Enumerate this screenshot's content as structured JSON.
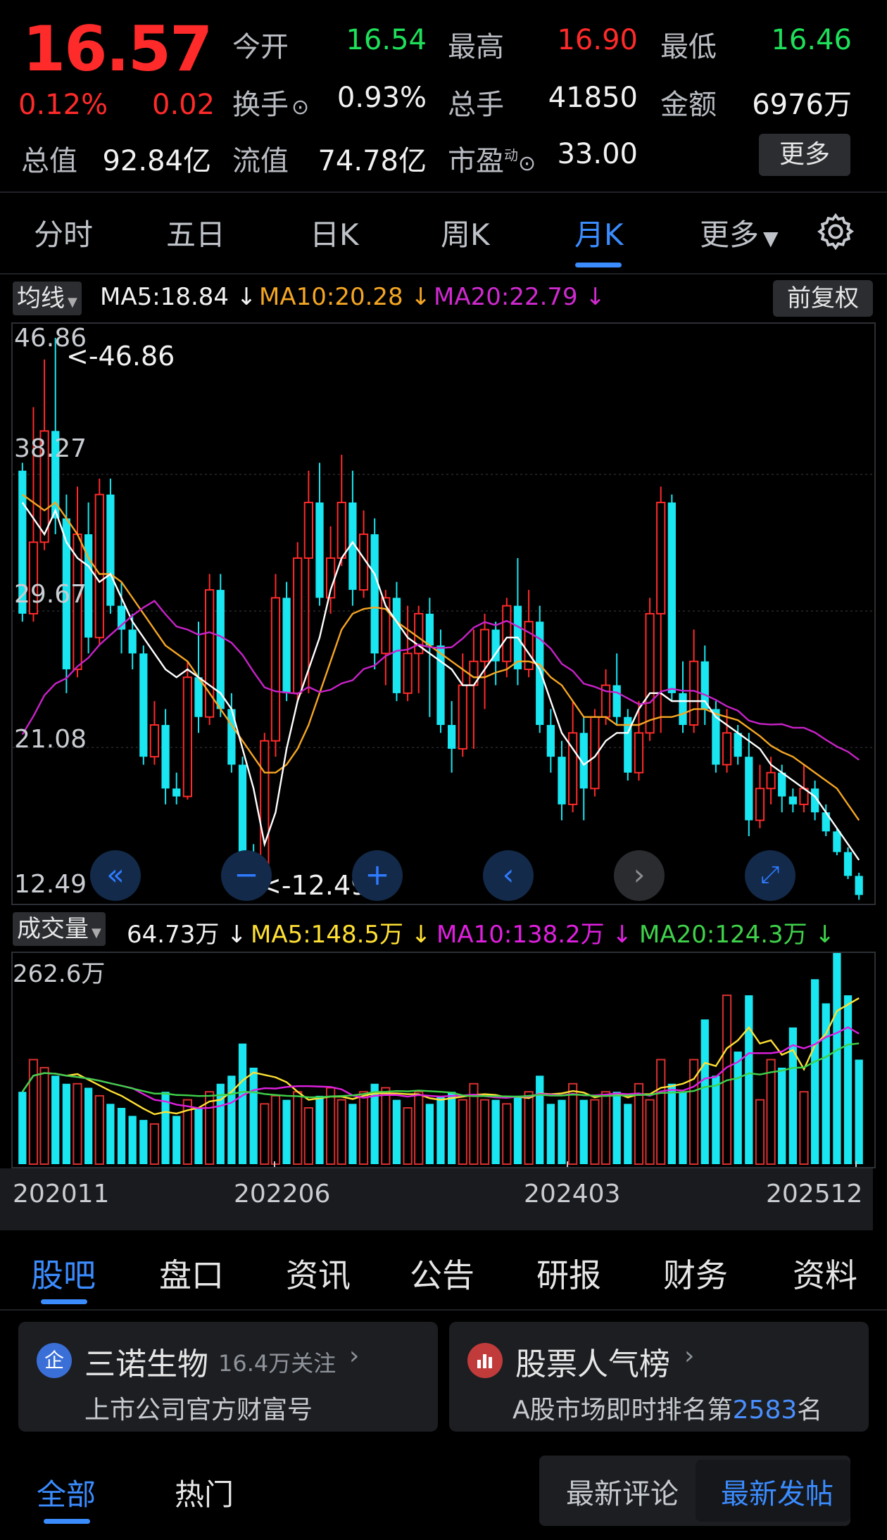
{
  "quote": {
    "price": "16.57",
    "change_pct": "0.12%",
    "change": "0.02",
    "open_label": "今开",
    "open": "16.54",
    "high_label": "最高",
    "high": "16.90",
    "low_label": "最低",
    "low": "16.46",
    "turnover_label": "换手",
    "turnover": "0.93%",
    "volume_label": "总手",
    "volume": "41850",
    "amount_label": "金额",
    "amount": "6976万",
    "mktcap_label": "总值",
    "mktcap": "92.84亿",
    "float_label": "流值",
    "float_cap": "74.78亿",
    "pe_label": "市盈",
    "pe_sup": "动",
    "pe": "33.00",
    "more_label": "更多"
  },
  "period_tabs": [
    "分时",
    "五日",
    "日K",
    "周K",
    "月K",
    "更多"
  ],
  "active_period": "月K",
  "kline": {
    "indicator_label": "均线",
    "ma5": "MA5:18.84 ↓",
    "ma10": "MA10:20.28 ↓",
    "ma20": "MA20:22.79 ↓",
    "adjust_label": "前复权",
    "y_ticks": [
      "46.86",
      "38.27",
      "29.67",
      "21.08",
      "12.49"
    ],
    "max_marker": "<-46.86",
    "min_marker": "<-12.49",
    "colors": {
      "up": "#ff2a2a",
      "down": "#19e6f0",
      "ma5": "#ffffff",
      "ma10": "#f5a623",
      "ma20": "#c822c8"
    }
  },
  "volume": {
    "indicator_label": "成交量",
    "vol": "64.73万 ↓",
    "ma5": "MA5:148.5万 ↓",
    "ma10": "MA10:138.2万 ↓",
    "ma20": "MA20:124.3万 ↓",
    "y_max": "262.6万",
    "x_ticks": [
      "202011",
      "202206",
      "202403",
      "202512"
    ],
    "colors": {
      "ma5": "#ffe033",
      "ma10": "#e020e0",
      "ma20": "#3fd24a"
    }
  },
  "chart_data": {
    "type": "candlestick",
    "candles": [
      [
        38.5,
        29.5,
        39.0,
        29.0
      ],
      [
        29.5,
        34.0,
        42.5,
        29.0
      ],
      [
        34.0,
        41.0,
        45.5,
        33.5
      ],
      [
        41.0,
        35.5,
        46.86,
        34.5
      ],
      [
        35.5,
        26.0,
        37.0,
        24.5
      ],
      [
        26.0,
        34.5,
        37.5,
        25.5
      ],
      [
        34.5,
        28.0,
        36.5,
        27.0
      ],
      [
        28.0,
        37.0,
        38.0,
        27.5
      ],
      [
        37.0,
        30.0,
        38.0,
        29.5
      ],
      [
        30.0,
        28.5,
        31.5,
        27.0
      ],
      [
        28.5,
        27.0,
        29.5,
        26.0
      ],
      [
        27.0,
        20.5,
        27.5,
        20.0
      ],
      [
        20.5,
        22.5,
        24.0,
        20.0
      ],
      [
        22.5,
        18.5,
        23.5,
        17.5
      ],
      [
        18.5,
        18.0,
        19.5,
        17.5
      ],
      [
        18.0,
        25.5,
        26.5,
        17.8
      ],
      [
        25.5,
        23.0,
        29.0,
        22.0
      ],
      [
        23.0,
        31.0,
        32.0,
        22.5
      ],
      [
        31.0,
        23.5,
        32.0,
        23.0
      ],
      [
        23.5,
        20.0,
        24.5,
        19.5
      ],
      [
        20.0,
        14.0,
        20.5,
        13.5
      ],
      [
        14.0,
        12.8,
        15.0,
        12.49
      ],
      [
        12.8,
        21.5,
        22.0,
        12.6
      ],
      [
        21.5,
        30.5,
        32.0,
        20.5
      ],
      [
        30.5,
        24.5,
        31.5,
        24.0
      ],
      [
        24.5,
        33.0,
        34.0,
        24.0
      ],
      [
        33.0,
        36.5,
        38.5,
        24.5
      ],
      [
        36.5,
        30.5,
        39.0,
        30.0
      ],
      [
        30.5,
        33.0,
        35.0,
        29.5
      ],
      [
        33.0,
        36.5,
        39.5,
        32.5
      ],
      [
        36.5,
        31.0,
        38.5,
        30.0
      ],
      [
        31.0,
        34.5,
        36.0,
        30.5
      ],
      [
        34.5,
        27.0,
        35.5,
        26.0
      ],
      [
        27.0,
        30.5,
        31.0,
        25.0
      ],
      [
        30.5,
        24.5,
        31.5,
        24.0
      ],
      [
        24.5,
        27.0,
        30.0,
        24.0
      ],
      [
        27.0,
        29.5,
        30.0,
        24.5
      ],
      [
        29.5,
        27.5,
        30.5,
        23.0
      ],
      [
        27.5,
        22.5,
        28.5,
        22.0
      ],
      [
        22.5,
        21.0,
        24.0,
        19.5
      ],
      [
        21.0,
        25.0,
        27.0,
        20.5
      ],
      [
        25.0,
        26.5,
        28.5,
        21.0
      ],
      [
        26.5,
        28.5,
        29.5,
        23.5
      ],
      [
        28.5,
        26.5,
        29.0,
        25.0
      ],
      [
        26.5,
        30.0,
        30.5,
        25.5
      ],
      [
        30.0,
        26.0,
        33.0,
        25.0
      ],
      [
        26.0,
        29.0,
        31.0,
        25.5
      ],
      [
        29.0,
        22.5,
        30.0,
        22.0
      ],
      [
        22.5,
        20.5,
        23.5,
        19.5
      ],
      [
        20.5,
        17.5,
        21.5,
        16.5
      ],
      [
        17.5,
        22.0,
        24.0,
        17.0
      ],
      [
        22.0,
        18.5,
        23.0,
        16.5
      ],
      [
        18.5,
        23.0,
        23.5,
        18.0
      ],
      [
        23.0,
        25.0,
        26.0,
        22.5
      ],
      [
        25.0,
        23.0,
        27.0,
        22.5
      ],
      [
        23.0,
        19.5,
        23.5,
        19.0
      ],
      [
        19.5,
        22.0,
        24.0,
        19.0
      ],
      [
        22.0,
        29.5,
        30.5,
        21.5
      ],
      [
        29.5,
        36.5,
        37.5,
        22.0
      ],
      [
        36.5,
        24.5,
        37.0,
        24.0
      ],
      [
        24.5,
        22.5,
        26.5,
        22.0
      ],
      [
        22.5,
        26.5,
        28.5,
        22.0
      ],
      [
        26.5,
        23.5,
        27.5,
        22.5
      ],
      [
        23.5,
        20.0,
        24.0,
        19.5
      ],
      [
        20.0,
        22.0,
        23.5,
        19.5
      ],
      [
        22.0,
        20.5,
        22.5,
        20.0
      ],
      [
        20.5,
        16.5,
        22.0,
        15.5
      ],
      [
        16.5,
        18.5,
        20.0,
        16.0
      ],
      [
        18.5,
        19.5,
        20.5,
        17.5
      ],
      [
        19.5,
        18.0,
        20.0,
        17.0
      ],
      [
        18.0,
        17.5,
        18.5,
        17.0
      ],
      [
        17.5,
        18.5,
        20.0,
        17.0
      ],
      [
        18.5,
        17.0,
        19.0,
        16.5
      ],
      [
        17.0,
        15.8,
        17.5,
        15.5
      ],
      [
        15.8,
        14.5,
        16.0,
        14.3
      ],
      [
        14.5,
        13.0,
        14.8,
        12.8
      ],
      [
        13.0,
        11.8,
        13.2,
        11.5
      ]
    ],
    "ma5": [
      36.5,
      35.5,
      34.5,
      36,
      34,
      33,
      32.5,
      31.5,
      32,
      30.5,
      29,
      28,
      27,
      26,
      25.5,
      26,
      25.5,
      25,
      24.5,
      23.5,
      21,
      18.5,
      15,
      17,
      21,
      24,
      26,
      28,
      31,
      33,
      34,
      33,
      32,
      30,
      29,
      28,
      27.5,
      27,
      26.5,
      26,
      25,
      25,
      26,
      27,
      28,
      28,
      27,
      26,
      24,
      22,
      21,
      20,
      20.5,
      21.5,
      22,
      22,
      23.5,
      24.5,
      24.5,
      24,
      24,
      24,
      24,
      23,
      22.5,
      22,
      21.5,
      21,
      20,
      19.5,
      19,
      18.5,
      18,
      17,
      16,
      15,
      14
    ],
    "ma10": [
      37,
      36.5,
      36,
      36.5,
      35.5,
      34.5,
      33,
      32,
      32,
      31.5,
      30.5,
      29.5,
      28.5,
      27.5,
      27,
      26.5,
      25.5,
      24.5,
      23.5,
      22.5,
      21.5,
      20.5,
      19.5,
      19.5,
      20,
      21,
      22.5,
      24.5,
      26.5,
      28.5,
      29.5,
      29.8,
      29.9,
      29.8,
      29,
      28.5,
      28,
      27.5,
      27,
      26.5,
      26,
      25.5,
      25.5,
      25.8,
      26,
      26.5,
      26.5,
      26.3,
      25.5,
      25,
      24,
      23,
      23,
      23,
      22.5,
      22.5,
      22.5,
      22.8,
      23,
      23,
      23.2,
      23.5,
      23.5,
      23.2,
      23,
      22.8,
      22.3,
      21.8,
      21.2,
      20.8,
      20.5,
      20,
      19.5,
      19,
      18.5,
      17.5,
      16.5
    ]
  },
  "bottom_tabs": [
    "股吧",
    "盘口",
    "资讯",
    "公告",
    "研报",
    "财务",
    "资料"
  ],
  "active_bottom_tab": "股吧",
  "company_card": {
    "badge": "企",
    "title": "三诺生物",
    "followers": "16.4万关注",
    "subtitle": "上市公司官方财富号"
  },
  "rank_card": {
    "title": "股票人气榜",
    "subtitle_prefix": "A股市场即时排名第",
    "rank": "2583",
    "subtitle_suffix": "名"
  },
  "feed_tabs": [
    "全部",
    "热门"
  ],
  "active_feed_tab": "全部",
  "sort_options": [
    "最新评论",
    "最新发帖"
  ],
  "active_sort": "最新发帖"
}
